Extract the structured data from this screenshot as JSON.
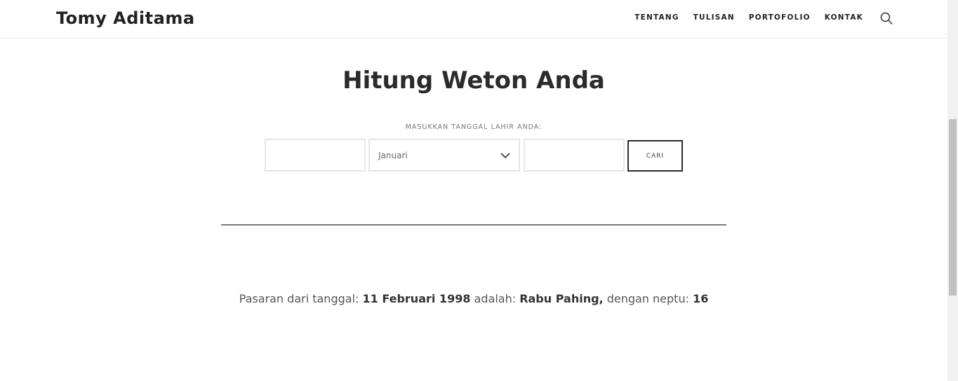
{
  "header": {
    "site_title": "Tomy Aditama",
    "nav": [
      {
        "label": "TENTANG"
      },
      {
        "label": "TULISAN"
      },
      {
        "label": "PORTOFOLIO"
      },
      {
        "label": "KONTAK"
      }
    ],
    "search_icon": "search-icon"
  },
  "main": {
    "title": "Hitung Weton Anda",
    "form_label": "MASUKKAN TANGGAL LAHIR ANDA:",
    "day_value": "",
    "month_value": "Januari",
    "year_value": "",
    "submit_label": "CARI",
    "result": {
      "prefix": "Pasaran dari tanggal: ",
      "date": "11 Februari 1998",
      "mid": " adalah: ",
      "weton": "Rabu Pahing,",
      "neptu_prefix": " dengan neptu: ",
      "neptu": "16"
    }
  },
  "colors": {
    "text": "#2b2b2b",
    "border": "#e6e6e6",
    "divider": "#7a7a7a"
  }
}
